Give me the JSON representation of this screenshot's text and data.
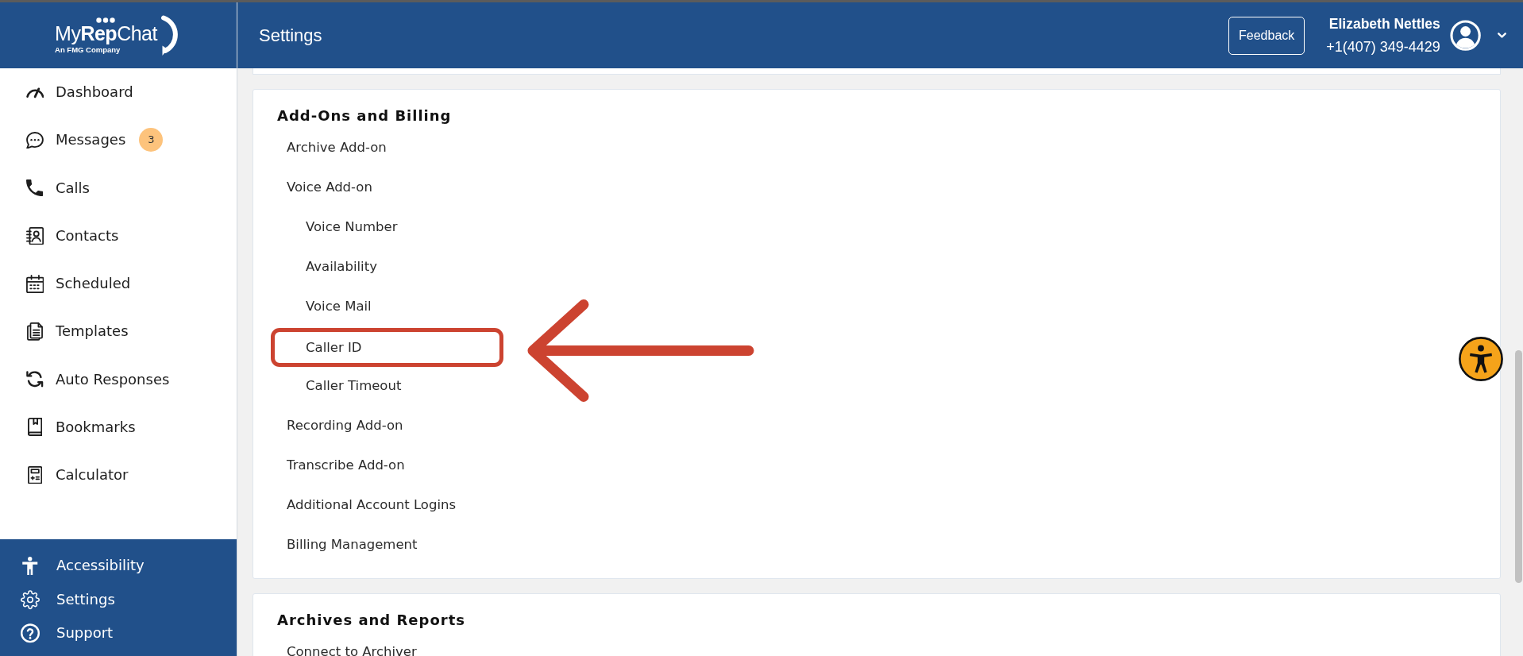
{
  "logo": {
    "wordmark": "My**Rep**Chat",
    "tagline": "An FMG Company"
  },
  "header": {
    "title": "Settings",
    "feedback_button": "Feedback",
    "user": {
      "name": "Elizabeth Nettles",
      "phone": "+1(407) 349-4429"
    }
  },
  "sidebar": {
    "items": [
      {
        "label": "Dashboard"
      },
      {
        "label": "Messages",
        "badge": "3"
      },
      {
        "label": "Calls"
      },
      {
        "label": "Contacts"
      },
      {
        "label": "Scheduled"
      },
      {
        "label": "Templates"
      },
      {
        "label": "Auto Responses"
      },
      {
        "label": "Bookmarks"
      },
      {
        "label": "Calculator"
      }
    ],
    "footer_items": [
      {
        "label": "Accessibility"
      },
      {
        "label": "Settings"
      },
      {
        "label": "Support"
      }
    ]
  },
  "sections": [
    {
      "title": "Add-Ons and Billing",
      "items": [
        {
          "label": "Archive Add-on",
          "highlighted": false
        },
        {
          "label": "Voice Add-on",
          "highlighted": false,
          "children": [
            {
              "label": "Voice Number",
              "highlighted": false
            },
            {
              "label": "Availability",
              "highlighted": false
            },
            {
              "label": "Voice Mail",
              "highlighted": false
            },
            {
              "label": "Caller ID",
              "highlighted": true
            },
            {
              "label": "Caller Timeout",
              "highlighted": false
            }
          ]
        },
        {
          "label": "Recording Add-on",
          "highlighted": false
        },
        {
          "label": "Transcribe Add-on",
          "highlighted": false
        },
        {
          "label": "Additional Account Logins",
          "highlighted": false
        },
        {
          "label": "Billing Management",
          "highlighted": false
        }
      ]
    },
    {
      "title": "Archives and Reports",
      "items": [
        {
          "label": "Connect to Archiver",
          "highlighted": false
        }
      ]
    }
  ]
}
